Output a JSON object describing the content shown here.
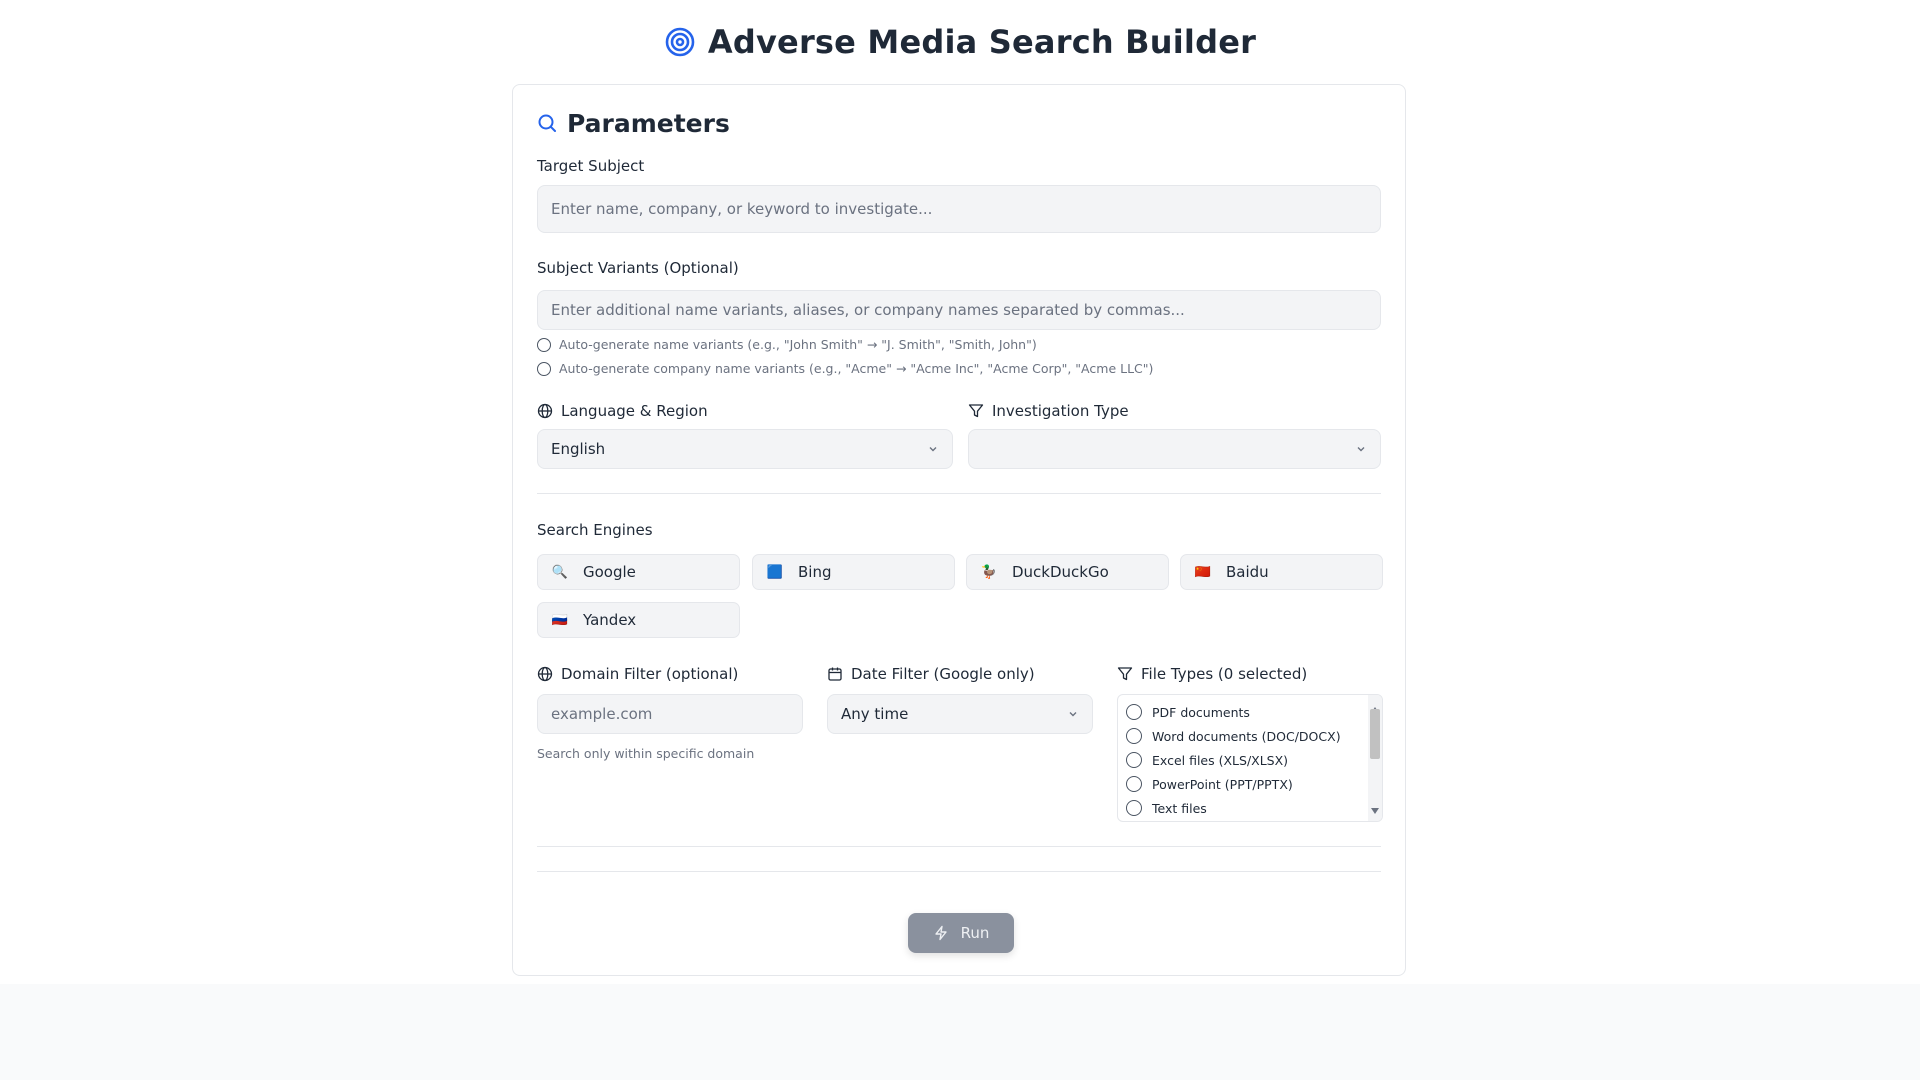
{
  "header": {
    "title": "Adverse Media Search Builder",
    "icon": "target-icon",
    "accent": "#2563eb"
  },
  "card": {
    "title": "Parameters",
    "icon": "search-icon"
  },
  "target": {
    "label": "Target Subject",
    "placeholder": "Enter name, company, or keyword to investigate...",
    "value": ""
  },
  "variants": {
    "label": "Subject Variants (Optional)",
    "placeholder": "Enter additional name variants, aliases, or company names separated by commas...",
    "options": [
      "Auto-generate name variants (e.g., \"John Smith\" → \"J. Smith\", \"Smith, John\")",
      "Auto-generate company name variants (e.g., \"Acme\" → \"Acme Inc\", \"Acme Corp\", \"Acme LLC\")"
    ]
  },
  "language": {
    "label": "Language & Region",
    "icon": "globe-icon",
    "value": "English"
  },
  "investigation": {
    "label": "Investigation Type",
    "icon": "filter-icon",
    "value": ""
  },
  "engines": {
    "label": "Search Engines",
    "items": [
      {
        "name": "Google",
        "icon": "🔍"
      },
      {
        "name": "Bing",
        "icon": "🟦"
      },
      {
        "name": "DuckDuckGo",
        "icon": "🦆"
      },
      {
        "name": "Baidu",
        "icon": "🇨🇳"
      },
      {
        "name": "Yandex",
        "icon": "🇷🇺"
      }
    ]
  },
  "domain": {
    "label": "Domain Filter (optional)",
    "icon": "globe-icon",
    "placeholder": "example.com",
    "hint": "Search only within specific domain"
  },
  "date": {
    "label": "Date Filter (Google only)",
    "icon": "calendar-icon",
    "value": "Any time"
  },
  "filetypes": {
    "label": "File Types (0 selected)",
    "icon": "filter-icon",
    "items": [
      "PDF documents",
      "Word documents (DOC/DOCX)",
      "Excel files (XLS/XLSX)",
      "PowerPoint (PPT/PPTX)",
      "Text files"
    ]
  },
  "run": {
    "label": "Run",
    "icon": "lightning-icon"
  }
}
